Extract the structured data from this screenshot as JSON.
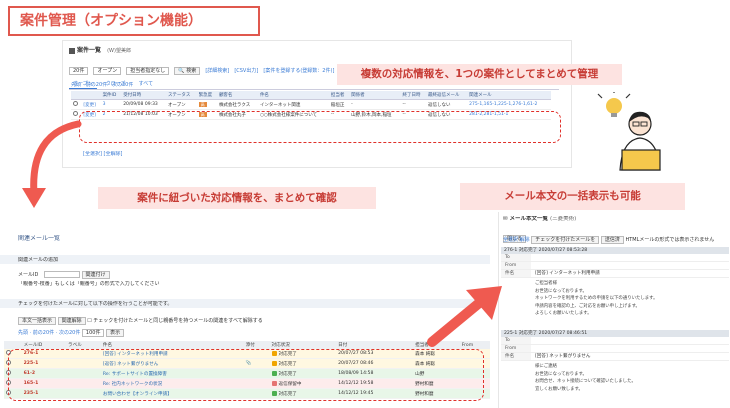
{
  "title": "案件管理（オプション機能）",
  "callouts": {
    "top": "複数の対応情報を、1つの案件としてまとめて管理",
    "middle": "案件に紐づいた対応情報を、まとめて確認",
    "right": "メール本文の一括表示も可能"
  },
  "case_list": {
    "title": "案件一覧",
    "user": "(W)望美郎",
    "count_select": "20件",
    "status_select": "オープン",
    "assignee_select": "担当者指定なし",
    "search_button": "検索",
    "toolbar_links": [
      "[詳細検索]",
      "[CSV出力]",
      "[案件を登録する(登録数：2件)]"
    ],
    "tabs": [
      "オープン",
      "クローズ",
      "すべて"
    ],
    "pagination": [
      "先頭",
      "前の20件",
      "次の20件"
    ],
    "columns": [
      "",
      "",
      "案件ID",
      "受付日時",
      "ステータス",
      "緊急度",
      "顧客名",
      "件名",
      "担当者",
      "関係者",
      "終了日時",
      "最終返信メール",
      "関連メール"
    ],
    "rows": [
      {
        "action": "[変更]",
        "id": "3",
        "date": "20/09/08 09:33",
        "status": "オープン",
        "priority": "高",
        "customer": "株式会社ラクス",
        "subject": "インターネット関連",
        "owner": "稲垣正",
        "related": "-",
        "end": "--",
        "reply": "返信しない",
        "mails": "275-1,165-1,225-1,276-1,61-2"
      },
      {
        "action": "[変更]",
        "id": "2",
        "date": "21/12/08 10:03",
        "status": "オープン",
        "priority": "高",
        "customer": "株式会社丸子",
        "subject": "○○株式会社様案件について",
        "owner": "--",
        "related": "山野,鈴木,岡本,稲垣",
        "end": "--",
        "reply": "返信しない",
        "mails": "281-2,281-1,51-1"
      }
    ],
    "footer_links": [
      "[全選択]",
      "[全解除]"
    ]
  },
  "mail_list": {
    "title": "関連メール一覧",
    "section": "関連メールの追加",
    "mail_id_label": "メールID",
    "add_button": "関連付け",
    "hint": "「親番号-枝番」もしくは「親番号」の形式で入力してください",
    "check_hint": "チェックを付けたメールに対して以下の操作を行うことが可能です。",
    "ops": [
      "本文一括表示",
      "関連解除",
      "チェックを付けたメールと同じ親番号を持つメールの関連をすべて解除する"
    ],
    "pagination": [
      "先頭",
      "前の20件",
      "次の20件"
    ],
    "per_page": "100件",
    "display_button": "表示",
    "columns": [
      "",
      "メールID",
      "ラベル",
      "件名",
      "添付",
      "対応状況",
      "日付",
      "担当者",
      "From"
    ],
    "rows": [
      {
        "id": "276-1",
        "subject": "[回答] インターネット利用申請",
        "attach": "",
        "status": "対応完了",
        "date": "20/07/27 08:53",
        "owner": "森本 純聡",
        "color": "#f0a500"
      },
      {
        "id": "225-1",
        "subject": "[返答] ネット繋がりません",
        "attach": "📎",
        "status": "対応完了",
        "date": "20/07/27 08:46",
        "owner": "森本 純聡",
        "color": "#f0a500"
      },
      {
        "id": "61-2",
        "subject": "Re: サポートサイトの置換障害",
        "attach": "",
        "status": "対応完了",
        "date": "18/08/09 14:58",
        "owner": "山野",
        "color": "#4caf50"
      },
      {
        "id": "165-1",
        "subject": "Re: 社内ネットワークの状況",
        "attach": "",
        "status": "返信保留中",
        "date": "14/12/12 19:58",
        "owner": "野村和麿",
        "color": "#e57373"
      },
      {
        "id": "235-1",
        "subject": "お問い合わせ【オンライン申請】",
        "attach": "",
        "status": "対応完了",
        "date": "14/12/12 19:45",
        "owner": "野村和麿",
        "color": "#4caf50"
      }
    ]
  },
  "mail_body": {
    "title": "メール本文一覧",
    "user": "(三菱美術)",
    "close_button": "閉じる",
    "toolbar": [
      "全選択",
      "解除",
      "チェックを付けたメールを",
      "送信済",
      "HTMLメールの形式では表示されません"
    ],
    "mails": [
      {
        "label": "276-1",
        "header": "対応完了  2020/07/27 08:53:28",
        "to": "",
        "from": "",
        "subject": "[回答] インターネット利用申請",
        "body": [
          "ご担当者様",
          "",
          "お世話になっております。",
          "ネットワークを利用するための申請を以下の通りいたします。",
          "",
          "申請内容を確認の上、ご対応をお願い申し上げます。",
          "よろしくお願いいたします。"
        ]
      },
      {
        "label": "225-1",
        "header": "対応完了  2020/07/27 08:46:51",
        "to": "",
        "from": "",
        "subject": "[回答] ネット繋がりません",
        "body": [
          "様にご連絡",
          "",
          "お世話になっております。",
          "",
          "お問合せ、ネット接続について確認いたしました。",
          "宜しくお願い致します。"
        ]
      }
    ]
  }
}
